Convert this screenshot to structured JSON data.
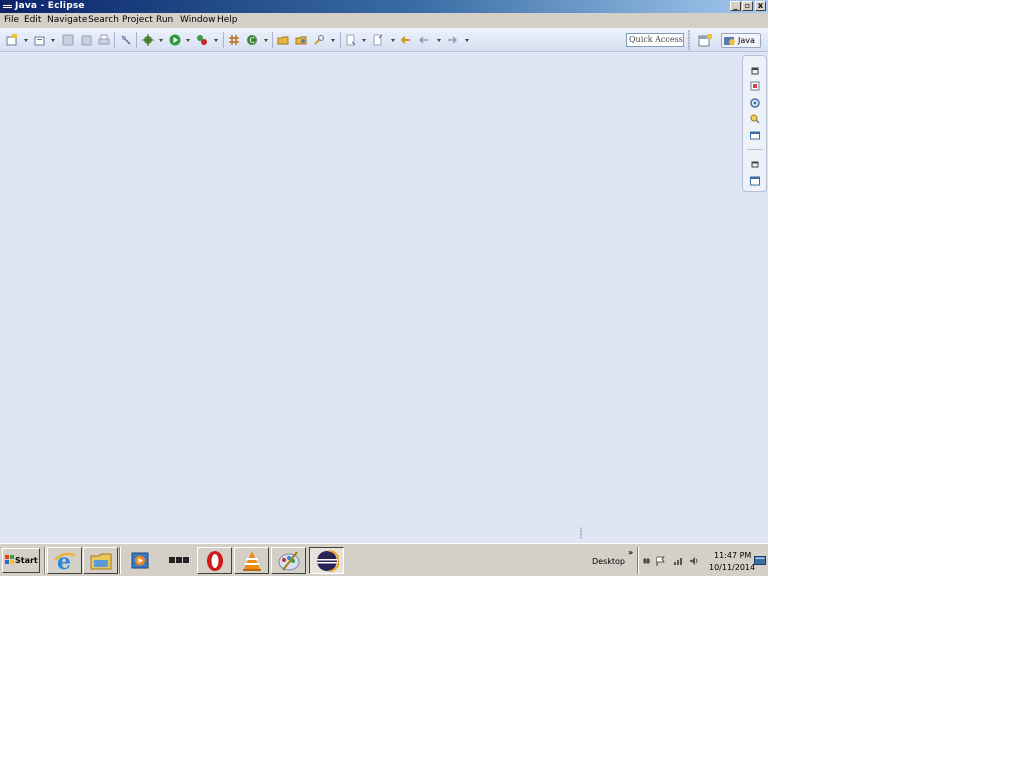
{
  "window": {
    "title": "Java - Eclipse",
    "controls": {
      "minimize": "_",
      "restore": "▫",
      "close": "x"
    }
  },
  "menubar": {
    "items": [
      "File",
      "Edit",
      "Navigate",
      "Search",
      "Project",
      "Run",
      "Window",
      "Help"
    ]
  },
  "toolbar": {
    "quick_access_placeholder": "Quick Access",
    "perspective": {
      "label": "Java"
    }
  },
  "taskbar": {
    "start_label": "Start",
    "desktop_label": "Desktop",
    "chevron": "»",
    "clock_time": "11:47 PM",
    "clock_date": "10/11/2014"
  }
}
